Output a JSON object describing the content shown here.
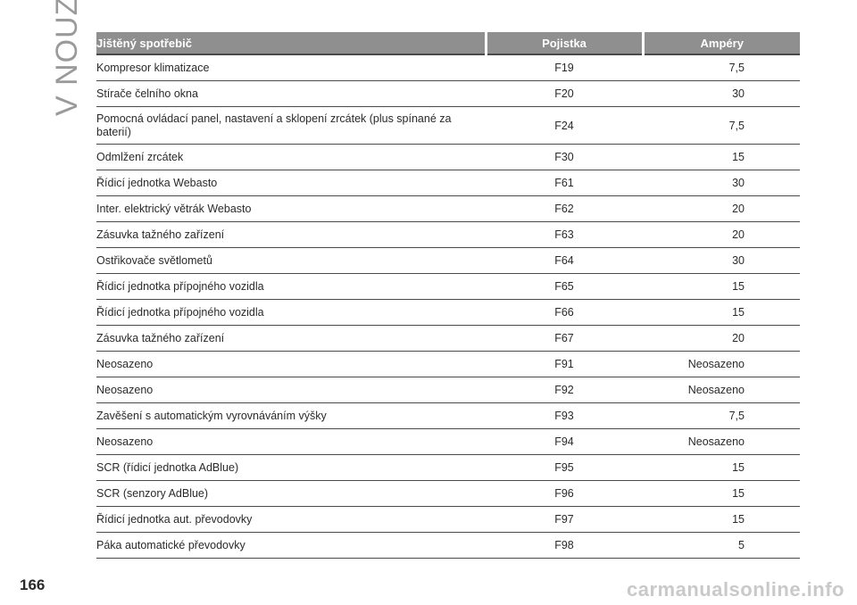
{
  "section_title": "V NOUZI",
  "page_number": "166",
  "watermark": "carmanualsonline.info",
  "table": {
    "headers": {
      "consumer": "Jištěný spotřebič",
      "fuse": "Pojistka",
      "amps": "Ampéry"
    },
    "rows": [
      {
        "consumer": "Kompresor klimatizace",
        "fuse": "F19",
        "amps": "7,5"
      },
      {
        "consumer": "Stírače čelního okna",
        "fuse": "F20",
        "amps": "30"
      },
      {
        "consumer": "Pomocná ovládací panel, nastavení a sklopení zrcátek (plus spínané za baterií)",
        "fuse": "F24",
        "amps": "7,5"
      },
      {
        "consumer": "Odmlžení zrcátek",
        "fuse": "F30",
        "amps": "15"
      },
      {
        "consumer": "Řídicí jednotka Webasto",
        "fuse": "F61",
        "amps": "30"
      },
      {
        "consumer": "Inter. elektrický větrák Webasto",
        "fuse": "F62",
        "amps": "20"
      },
      {
        "consumer": "Zásuvka tažného zařízení",
        "fuse": "F63",
        "amps": "20"
      },
      {
        "consumer": "Ostřikovače světlometů",
        "fuse": "F64",
        "amps": "30"
      },
      {
        "consumer": "Řídicí jednotka přípojného vozidla",
        "fuse": "F65",
        "amps": "15"
      },
      {
        "consumer": "Řídicí jednotka přípojného vozidla",
        "fuse": "F66",
        "amps": "15"
      },
      {
        "consumer": "Zásuvka tažného zařízení",
        "fuse": "F67",
        "amps": "20"
      },
      {
        "consumer": "Neosazeno",
        "fuse": "F91",
        "amps": "Neosazeno"
      },
      {
        "consumer": "Neosazeno",
        "fuse": "F92",
        "amps": "Neosazeno"
      },
      {
        "consumer": "Zavěšení s automatickým vyrovnáváním výšky",
        "fuse": "F93",
        "amps": "7,5"
      },
      {
        "consumer": "Neosazeno",
        "fuse": "F94",
        "amps": "Neosazeno"
      },
      {
        "consumer": "SCR (řídicí jednotka AdBlue)",
        "fuse": "F95",
        "amps": "15"
      },
      {
        "consumer": "SCR (senzory AdBlue)",
        "fuse": "F96",
        "amps": "15"
      },
      {
        "consumer": "Řídicí jednotka aut. převodovky",
        "fuse": "F97",
        "amps": "15"
      },
      {
        "consumer": "Páka automatické převodovky",
        "fuse": "F98",
        "amps": "5"
      }
    ]
  }
}
